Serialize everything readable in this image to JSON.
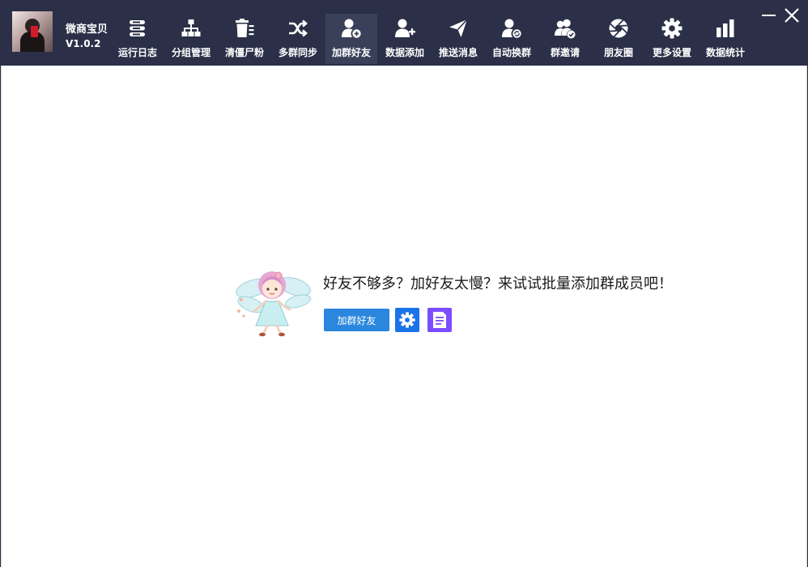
{
  "app": {
    "name": "微商宝贝",
    "version": "V1.0.2"
  },
  "toolbar": {
    "items": [
      {
        "label": "运行日志",
        "icon": "server-log-icon"
      },
      {
        "label": "分组管理",
        "icon": "org-tree-icon"
      },
      {
        "label": "清僵尸粉",
        "icon": "trash-icon"
      },
      {
        "label": "多群同步",
        "icon": "shuffle-icon"
      },
      {
        "label": "加群好友",
        "icon": "user-add-circle-icon",
        "active": true
      },
      {
        "label": "数据添加",
        "icon": "user-plus-icon"
      },
      {
        "label": "推送消息",
        "icon": "paper-plane-icon"
      },
      {
        "label": "自动换群",
        "icon": "user-sync-icon"
      },
      {
        "label": "群邀请",
        "icon": "users-check-icon"
      },
      {
        "label": "朋友圈",
        "icon": "aperture-icon"
      },
      {
        "label": "更多设置",
        "icon": "gear-icon"
      },
      {
        "label": "数据统计",
        "icon": "bar-chart-icon"
      }
    ]
  },
  "main": {
    "promo_text": "好友不够多？加好友太慢？来试试批量添加群成员吧！",
    "add_button_label": "加群好友",
    "settings_icon": "gear-icon",
    "log_icon": "document-icon"
  },
  "colors": {
    "topbar": "#2b3048",
    "active_tab": "#3a4059",
    "primary_button": "#2b87de",
    "settings_button": "#1a73e8",
    "log_button": "#7c4dff"
  }
}
